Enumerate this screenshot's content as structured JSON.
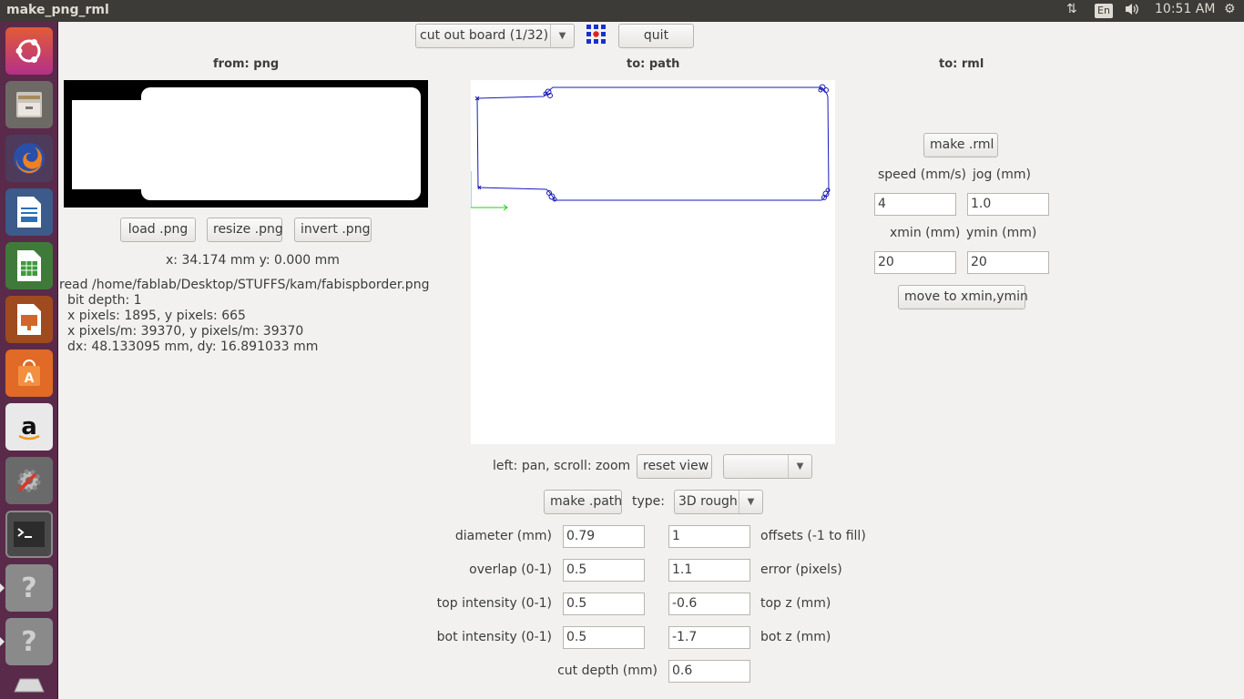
{
  "topbar": {
    "title": "make_png_rml",
    "net_icon": "⇅",
    "lang": "En",
    "sound_icon": "🔊",
    "clock": "10:51 AM",
    "gear_icon": "⚙"
  },
  "launcher": {
    "items": [
      "ubuntu-dash",
      "files",
      "firefox",
      "libreoffice-writer",
      "libreoffice-calc",
      "libreoffice-impress",
      "ubuntu-software",
      "amazon",
      "system-settings",
      "terminal",
      "unknown-app",
      "unknown-app",
      "usb-drive"
    ]
  },
  "toolbar": {
    "process_select": "cut out board (1/32)",
    "quit": "quit"
  },
  "headers": {
    "from_png": "from: png",
    "to_path": "to: path",
    "to_rml": "to: rml"
  },
  "png": {
    "load": "load .png",
    "resize": "resize .png",
    "invert": "invert .png",
    "coords": "x: 34.174 mm  y: 0.000 mm",
    "info": [
      "read /home/fablab/Desktop/STUFFS/kam/fabispborder.png",
      "  bit depth: 1",
      "  x pixels: 1895, y pixels: 665",
      "  x pixels/m: 39370, y pixels/m: 39370",
      "  dx: 48.133095 mm, dy: 16.891033 mm"
    ]
  },
  "path": {
    "hint": "left: pan, scroll: zoom",
    "reset_view": "reset view",
    "view_select": "",
    "make_path": "make .path",
    "type_label": "type:",
    "type_value": "3D rough",
    "diameter_label": "diameter (mm)",
    "diameter": "0.79",
    "offsets": "1",
    "offsets_label": "offsets (-1 to fill)",
    "overlap_label": "overlap (0-1)",
    "overlap": "0.5",
    "error": "1.1",
    "error_label": "error (pixels)",
    "top_intensity_label": "top intensity (0-1)",
    "top_intensity": "0.5",
    "top_z": "-0.6",
    "top_z_label": "top z (mm)",
    "bot_intensity_label": "bot intensity (0-1)",
    "bot_intensity": "0.5",
    "bot_z": "-1.7",
    "bot_z_label": "bot z (mm)",
    "cut_depth_label": "cut depth (mm)",
    "cut_depth": "0.6"
  },
  "rml": {
    "make_rml": "make .rml",
    "speed_label": "speed (mm/s)",
    "jog_label": "jog (mm)",
    "speed": "4",
    "jog": "1.0",
    "xmin_label": "xmin (mm)",
    "ymin_label": "ymin (mm)",
    "xmin": "20",
    "ymin": "20",
    "move": "move to xmin,ymin"
  }
}
